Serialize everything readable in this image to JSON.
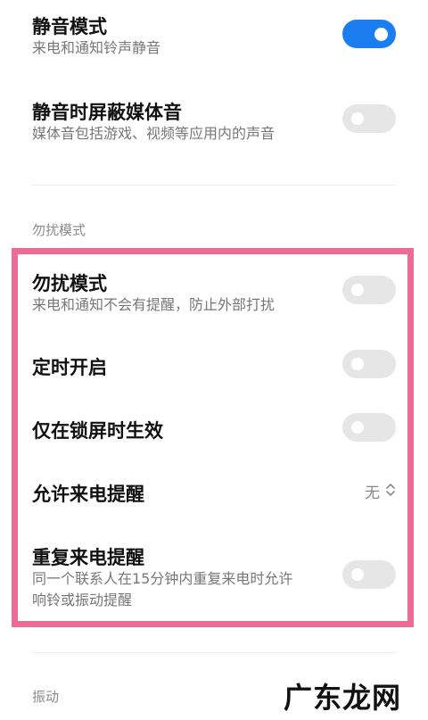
{
  "sound": {
    "silent_mode": {
      "title": "静音模式",
      "subtitle": "来电和通知铃声静音",
      "on": true
    },
    "mute_media": {
      "title": "静音时屏蔽媒体音",
      "subtitle": "媒体音包括游戏、视频等应用内的声音",
      "on": false
    }
  },
  "dnd": {
    "section_label": "勿扰模式",
    "dnd_mode": {
      "title": "勿扰模式",
      "subtitle": "来电和通知不会有提醒，防止外部打扰",
      "on": false
    },
    "scheduled": {
      "title": "定时开启",
      "on": false
    },
    "lockscreen_only": {
      "title": "仅在锁屏时生效",
      "on": false
    },
    "allow_calls": {
      "title": "允许来电提醒",
      "value": "无"
    },
    "repeat_calls": {
      "title": "重复来电提醒",
      "subtitle_line1": "同一个联系人在15分钟内重复来电时允许",
      "subtitle_line2": "响铃或振动提醒",
      "on": false
    }
  },
  "vibration": {
    "section_label": "振动"
  },
  "colors": {
    "accent": "#1a7df0",
    "highlight": "#ef6b96",
    "toggle_off": "#e6e6e6"
  },
  "watermark": "广东龙网"
}
